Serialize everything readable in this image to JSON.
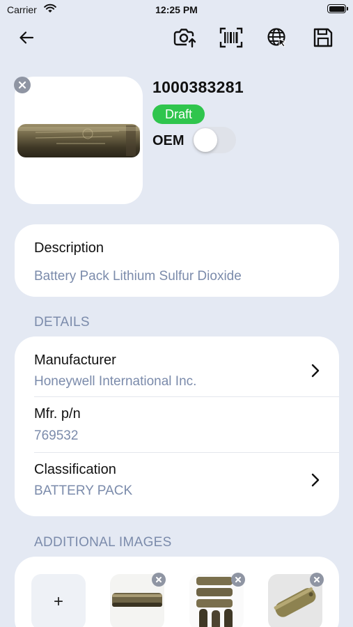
{
  "status_bar": {
    "carrier": "Carrier",
    "time": "12:25 PM"
  },
  "nav": {
    "back_icon": "back-arrow-icon",
    "actions": [
      "camera-upload-icon",
      "barcode-scan-icon",
      "globe-icon",
      "save-icon"
    ]
  },
  "item": {
    "part_number": "1000383281",
    "status": "Draft",
    "oem_label": "OEM",
    "oem_enabled": false
  },
  "description": {
    "label": "Description",
    "value": "Battery Pack Lithium Sulfur Dioxide"
  },
  "details": {
    "header": "DETAILS",
    "manufacturer": {
      "label": "Manufacturer",
      "value": "Honeywell International Inc."
    },
    "mfr_pn": {
      "label": "Mfr. p/n",
      "value": "769532"
    },
    "classification": {
      "label": "Classification",
      "value": "BATTERY PACK"
    }
  },
  "additional_images": {
    "header": "ADDITIONAL IMAGES",
    "add_label": "+"
  },
  "colors": {
    "accent_green": "#2fc54d",
    "secondary_text": "#7b8bab",
    "background": "#e4e9f3"
  }
}
